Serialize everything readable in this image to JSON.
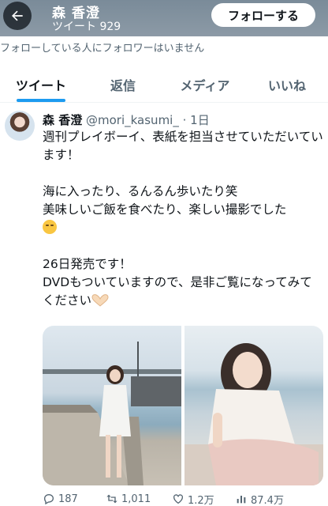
{
  "header": {
    "profile_name": "森 香澄",
    "tweet_count": "ツイート 929",
    "follow_label": "フォローする"
  },
  "notice": "フォローしている人にフォロワーはいません",
  "tabs": [
    {
      "label": "ツイート",
      "active": true
    },
    {
      "label": "返信",
      "active": false
    },
    {
      "label": "メディア",
      "active": false
    },
    {
      "label": "いいね",
      "active": false
    }
  ],
  "tweet": {
    "author_name": "森 香澄",
    "author_meta": " @mori_kasumi_ · 1日",
    "lines": [
      "週刊プレイボーイ、表紙を担当させていただいています！",
      "",
      "海に入ったり、るんるん歩いたり笑",
      "美味しいご飯を食べたり、楽しい撮影でした",
      "",
      "26日発売です！",
      "DVDもついていますので、是非ご覧になってみてください"
    ],
    "stats": {
      "replies": "187",
      "retweets": "1,011",
      "likes": "1.2万",
      "views": "87.4万"
    }
  },
  "colors": {
    "accent": "#1d9bf0",
    "text": "#0f1419",
    "muted": "#536471"
  }
}
